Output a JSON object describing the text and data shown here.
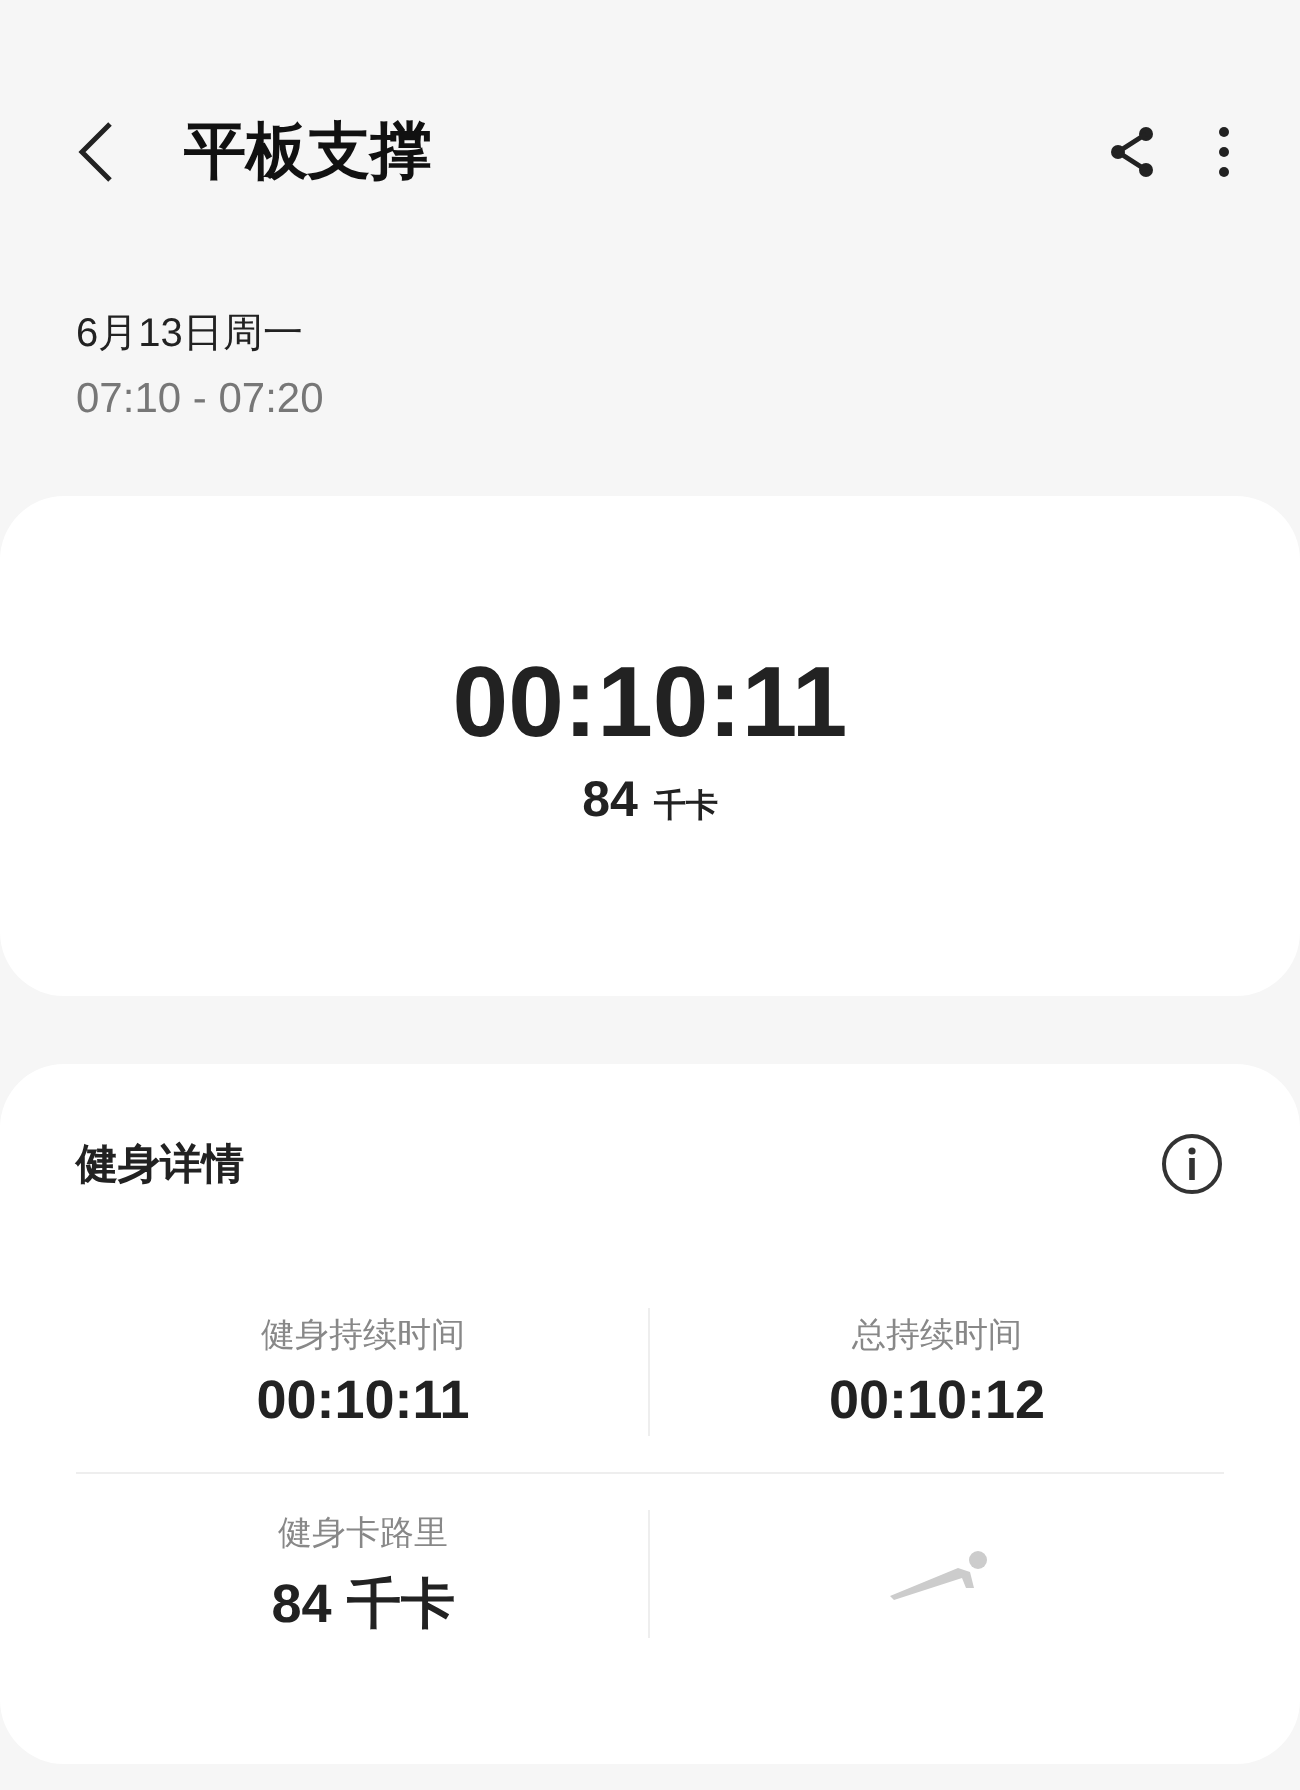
{
  "header": {
    "title": "平板支撑"
  },
  "session": {
    "date": "6月13日周一",
    "time_range": "07:10 - 07:20"
  },
  "summary": {
    "duration": "00:10:11",
    "calories_value": "84",
    "calories_unit": "千卡"
  },
  "details": {
    "title": "健身详情",
    "stats": [
      {
        "kind": "text",
        "label": "健身持续时间",
        "value": "00:10:11"
      },
      {
        "kind": "text",
        "label": "总持续时间",
        "value": "00:10:12"
      },
      {
        "kind": "text",
        "label": "健身卡路里",
        "value": "84 千卡"
      },
      {
        "kind": "figure"
      }
    ]
  }
}
